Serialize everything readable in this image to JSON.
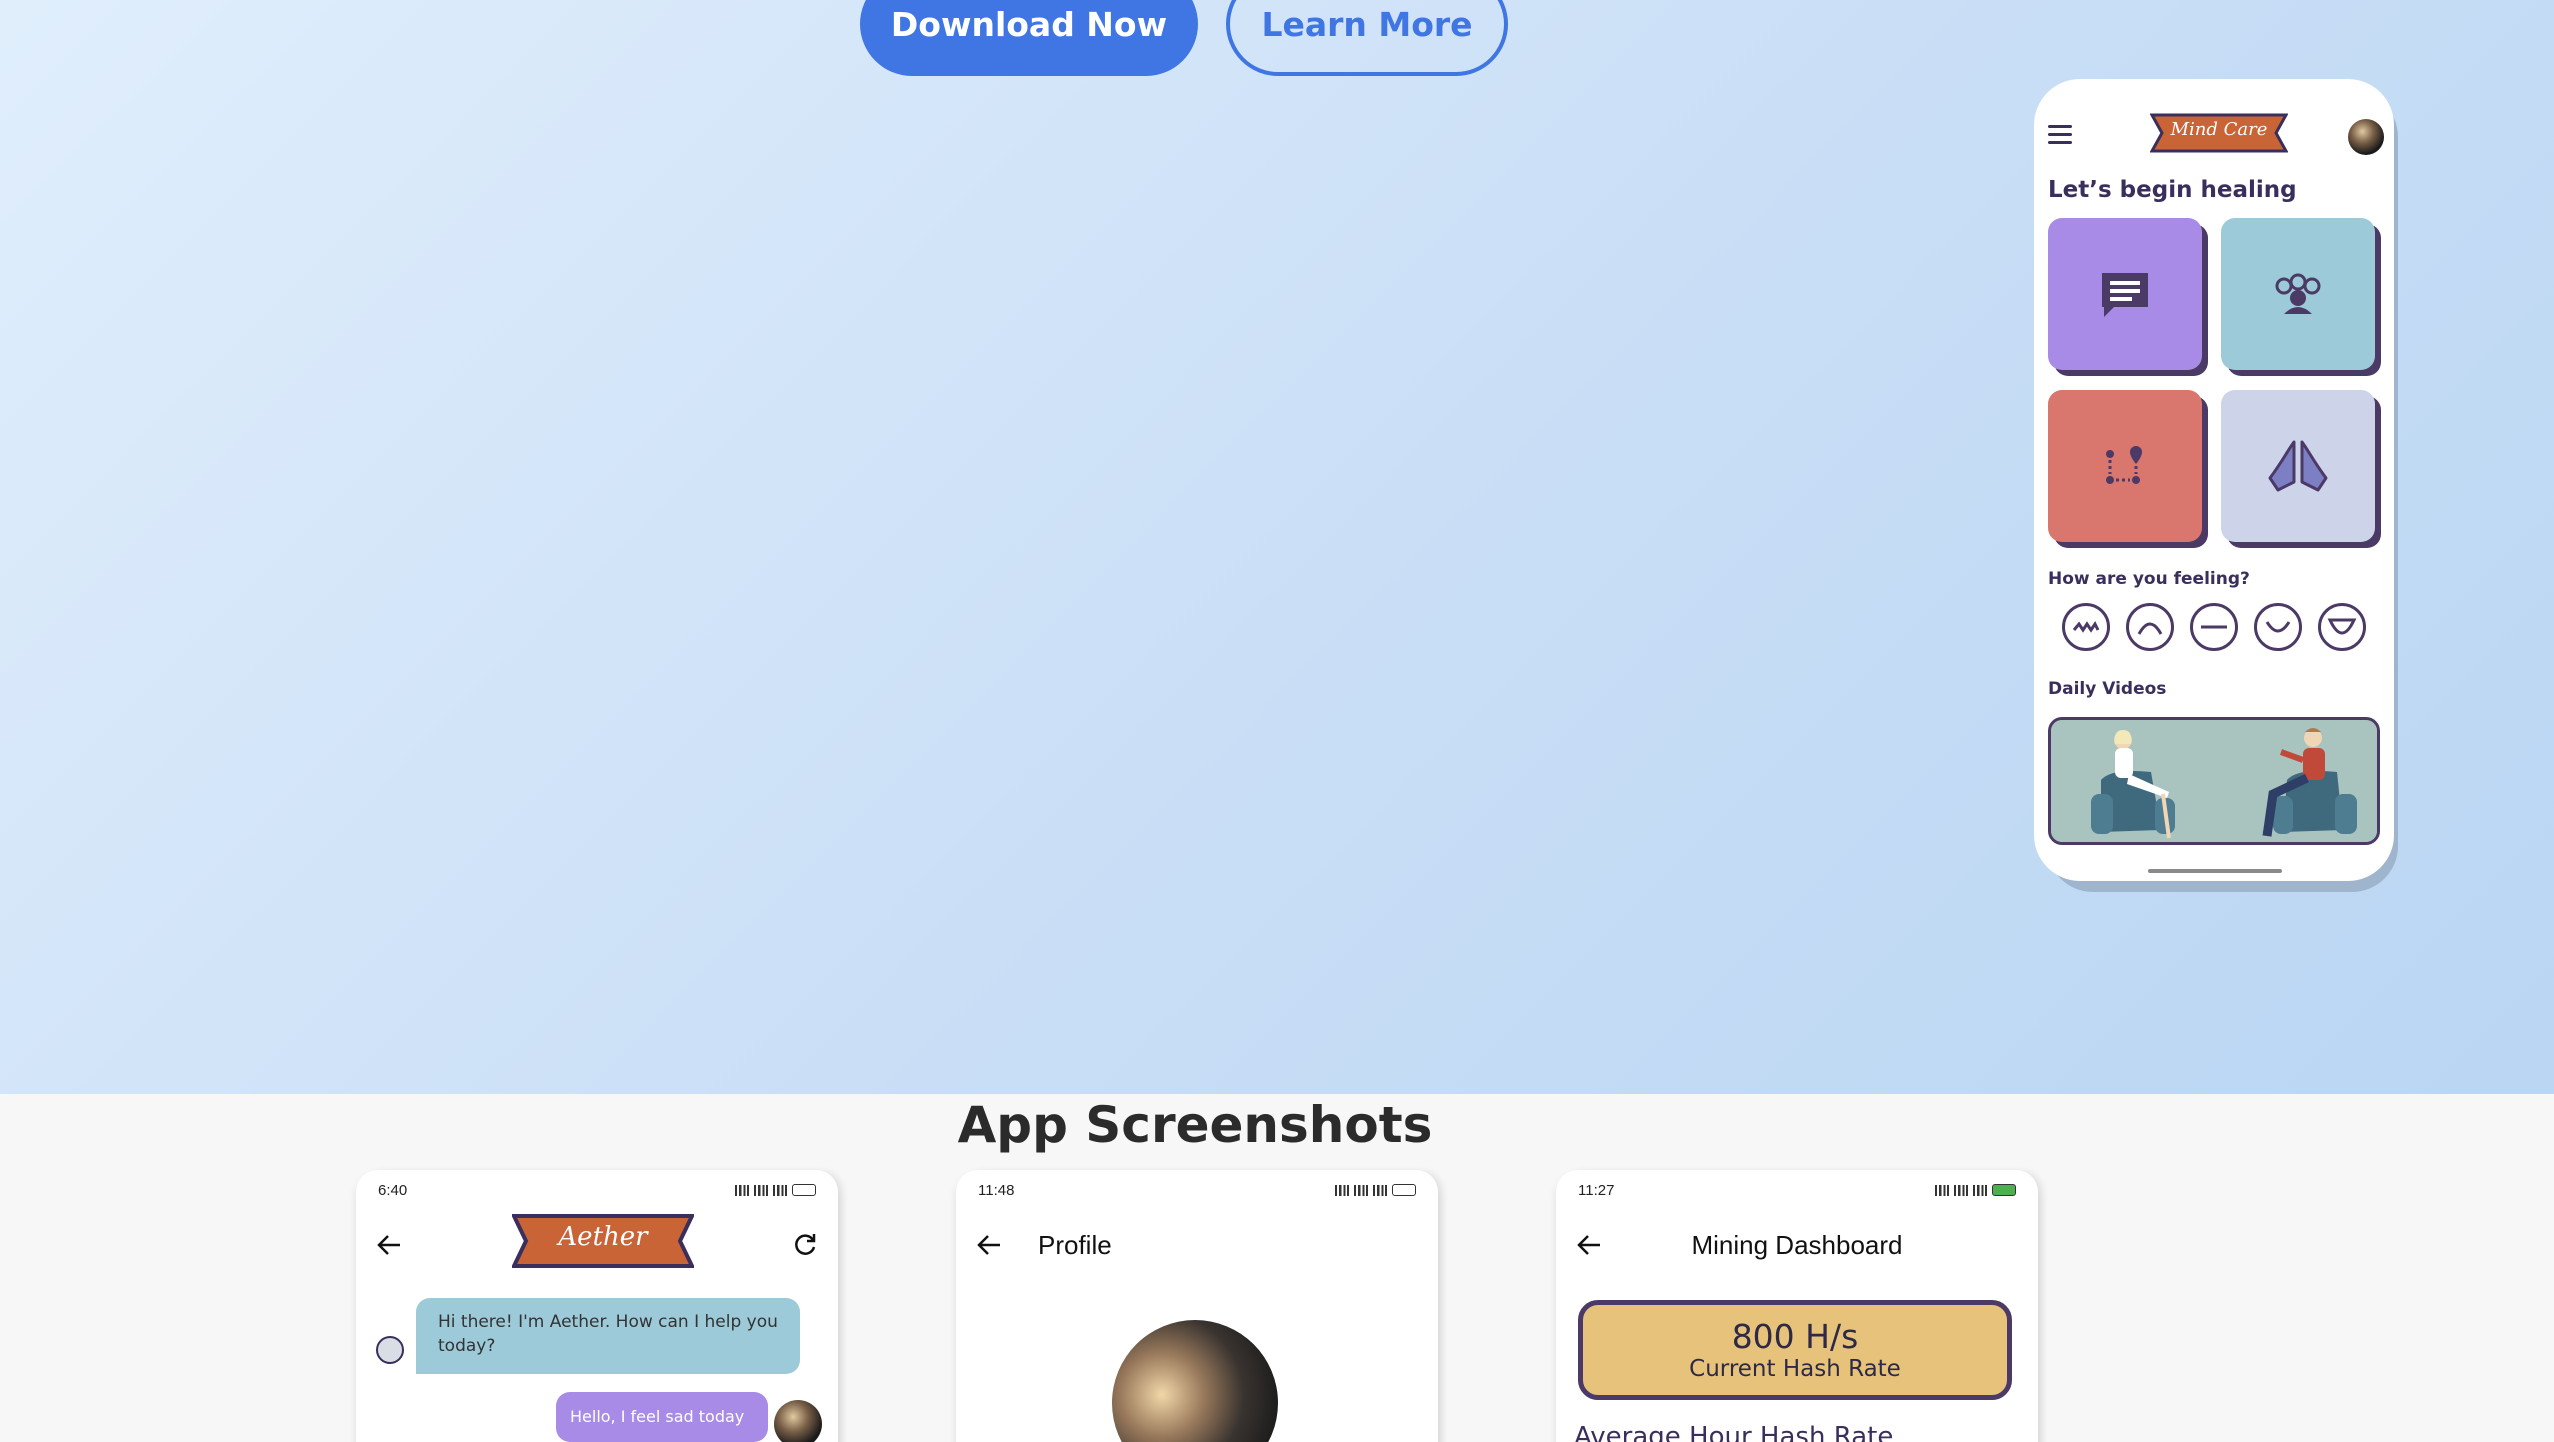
{
  "hero": {
    "download_label": "Download Now",
    "learn_label": "Learn More"
  },
  "mindcare": {
    "logo_text": "Mind Care",
    "heading": "Let’s begin healing",
    "mood_question": "How are you feeling?",
    "videos_label": "Daily Videos",
    "tiles": [
      {
        "name": "chat",
        "color": "#a78be6",
        "icon": "chat-icon"
      },
      {
        "name": "community",
        "color": "#9ccad9",
        "icon": "community-icon"
      },
      {
        "name": "journey",
        "color": "#d9776e",
        "icon": "map-pins-icon"
      },
      {
        "name": "prayer",
        "color": "#cdd3e8",
        "icon": "praying-hands-icon"
      }
    ],
    "moods": [
      "very-sad",
      "sad",
      "neutral",
      "happy",
      "very-happy"
    ]
  },
  "section": {
    "title": "App Screenshots"
  },
  "screenshots": {
    "chat": {
      "time": "6:40",
      "logo_text": "Aether",
      "bot_message": "Hi there! I'm Aether. How can I help you today?",
      "user_message": "Hello, I feel sad today"
    },
    "profile": {
      "time": "11:48",
      "title": "Profile"
    },
    "mining": {
      "time": "11:27",
      "title": "Mining Dashboard",
      "hash_rate": "800 H/s",
      "hash_label": "Current Hash Rate",
      "avg_label": "Average Hour Hash Rate"
    }
  },
  "colors": {
    "primary": "#3f76e4",
    "accent_orange": "#c96437",
    "dark_purple": "#4b3966",
    "gold": "#e6c27a"
  }
}
